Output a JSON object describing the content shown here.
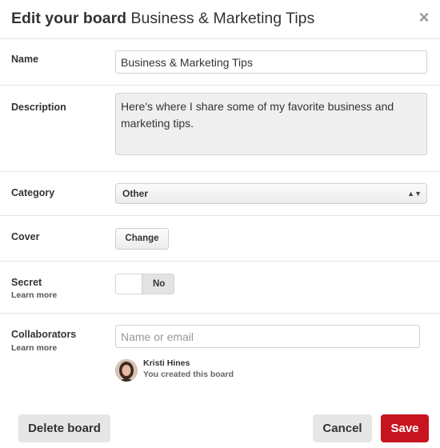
{
  "header": {
    "title_prefix": "Edit your board",
    "board_name": "Business & Marketing Tips",
    "close_label": "×"
  },
  "name": {
    "label": "Name",
    "value": "Business & Marketing Tips"
  },
  "description": {
    "label": "Description",
    "value": "Here's where I share some of my favorite business and marketing tips."
  },
  "category": {
    "label": "Category",
    "selected": "Other",
    "arrows": "▲▼"
  },
  "cover": {
    "label": "Cover",
    "button": "Change"
  },
  "secret": {
    "label": "Secret",
    "learn_more": "Learn more",
    "toggle_state": "No"
  },
  "collaborators": {
    "label": "Collaborators",
    "learn_more": "Learn more",
    "placeholder": "Name or email",
    "list": [
      {
        "name": "Kristi Hines",
        "subtitle": "You created this board"
      }
    ]
  },
  "footer": {
    "delete_label": "Delete board",
    "cancel_label": "Cancel",
    "save_label": "Save"
  },
  "colors": {
    "save_bg": "#c8141f",
    "gray_btn": "#e6e6e6",
    "divider": "#e5e5e5"
  }
}
